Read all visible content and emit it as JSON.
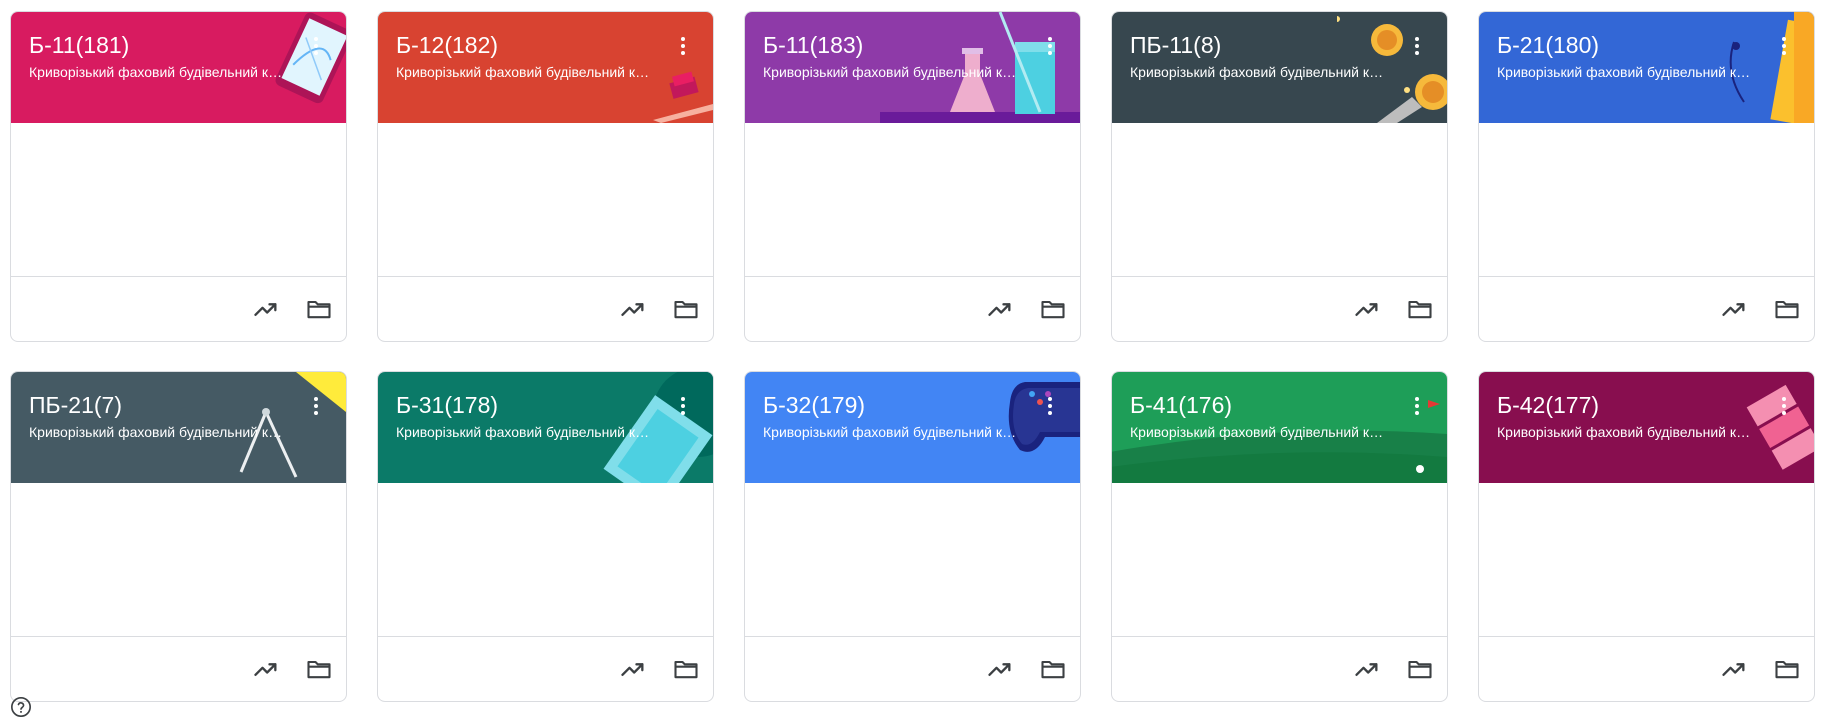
{
  "classes": [
    {
      "name": "Б-11(181)",
      "section": "Криворізький фаховий будівельний коледж",
      "color": "#d81b60",
      "deco": "tablet"
    },
    {
      "name": "Б-12(182)",
      "section": "Криворізький фаховий будівельний коледж",
      "color": "#d84331",
      "deco": "books"
    },
    {
      "name": "Б-11(183)",
      "section": "Криворізький фаховий будівельний коледж",
      "color": "#8e3aa8",
      "deco": "flask"
    },
    {
      "name": "ПБ-11(8)",
      "section": "Криворізький фаховий будівельний коледж",
      "color": "#37474f",
      "deco": "coins"
    },
    {
      "name": "Б-21(180)",
      "section": "Криворізький фаховий будівельний коледж",
      "color": "#3367d6",
      "deco": "notebook"
    },
    {
      "name": "ПБ-21(7)",
      "section": "Криворізький фаховий будівельний коледж",
      "color": "#455a64",
      "deco": "compass"
    },
    {
      "name": "Б-31(178)",
      "section": "Криворізький фаховий будівельний коледж",
      "color": "#0b7a68",
      "deco": "money"
    },
    {
      "name": "Б-32(179)",
      "section": "Криворізький фаховий будівельний коледж",
      "color": "#4285f4",
      "deco": "gamepad"
    },
    {
      "name": "Б-41(176)",
      "section": "Криворізький фаховий будівельний коледж",
      "color": "#1e9e58",
      "deco": "golf"
    },
    {
      "name": "Б-42(177)",
      "section": "Криворізький фаховий будівельний коледж",
      "color": "#880e4f",
      "deco": "tickets"
    }
  ],
  "footer_icons": [
    "trending-up-icon",
    "folder-icon"
  ],
  "help_icon": "help-icon"
}
